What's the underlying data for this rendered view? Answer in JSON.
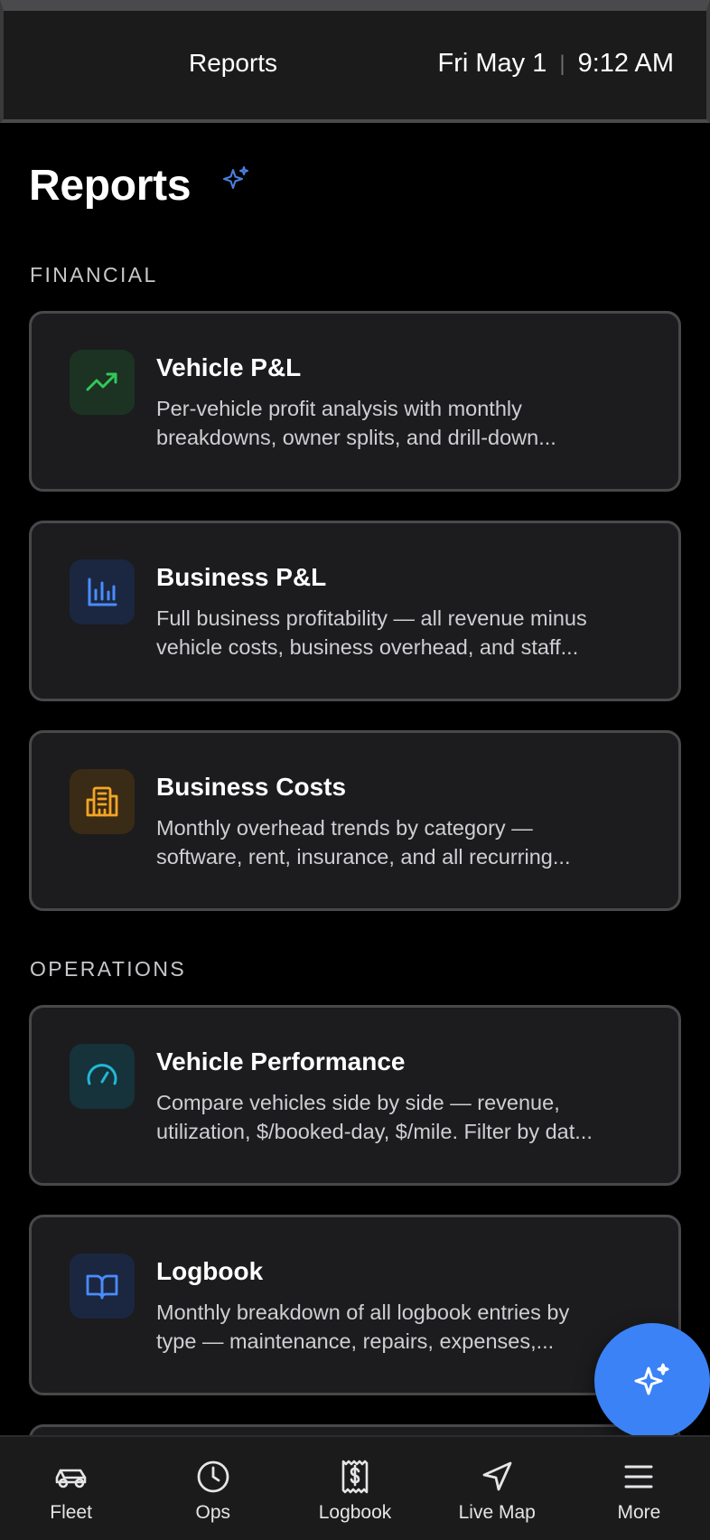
{
  "header": {
    "title": "Reports",
    "date": "Fri May 1",
    "separator": "|",
    "time": "9:12 AM"
  },
  "page": {
    "title": "Reports",
    "sparkle_icon": "sparkle-icon"
  },
  "sections": [
    {
      "label": "FINANCIAL",
      "cards": [
        {
          "title": "Vehicle P&L",
          "desc_line1": "Per-vehicle profit analysis with monthly",
          "desc_line2": "breakdowns, owner splits, and drill-down...",
          "icon": "trending-up-icon",
          "icon_color": "#34c759",
          "icon_bg": "#1c3324"
        },
        {
          "title": "Business P&L",
          "desc_line1": "Full business profitability — all revenue minus",
          "desc_line2": "vehicle costs, business overhead, and staff...",
          "icon": "bar-chart-icon",
          "icon_color": "#4a8cff",
          "icon_bg": "#1b2740"
        },
        {
          "title": "Business Costs",
          "desc_line1": "Monthly overhead trends by category —",
          "desc_line2": "software, rent, insurance, and all recurring...",
          "icon": "building-icon",
          "icon_color": "#f5a524",
          "icon_bg": "#3a2b16"
        }
      ]
    },
    {
      "label": "OPERATIONS",
      "cards": [
        {
          "title": "Vehicle Performance",
          "desc_line1": "Compare vehicles side by side — revenue,",
          "desc_line2": "utilization, $/booked-day, $/mile. Filter by dat...",
          "icon": "gauge-icon",
          "icon_color": "#22b8d6",
          "icon_bg": "#16323a"
        },
        {
          "title": "Logbook",
          "desc_line1": "Monthly breakdown of all logbook entries by",
          "desc_line2": "type — maintenance, repairs, expenses,...",
          "icon": "book-open-icon",
          "icon_color": "#4a8cff",
          "icon_bg": "#1b2740"
        }
      ]
    }
  ],
  "nav": {
    "items": [
      {
        "label": "Fleet",
        "icon": "car-icon"
      },
      {
        "label": "Ops",
        "icon": "clock-icon"
      },
      {
        "label": "Logbook",
        "icon": "receipt-icon"
      },
      {
        "label": "Live Map",
        "icon": "navigation-icon"
      },
      {
        "label": "More",
        "icon": "menu-icon"
      }
    ]
  },
  "fab": {
    "icon": "ai-sparkle-icon",
    "color": "#3b82f6"
  }
}
